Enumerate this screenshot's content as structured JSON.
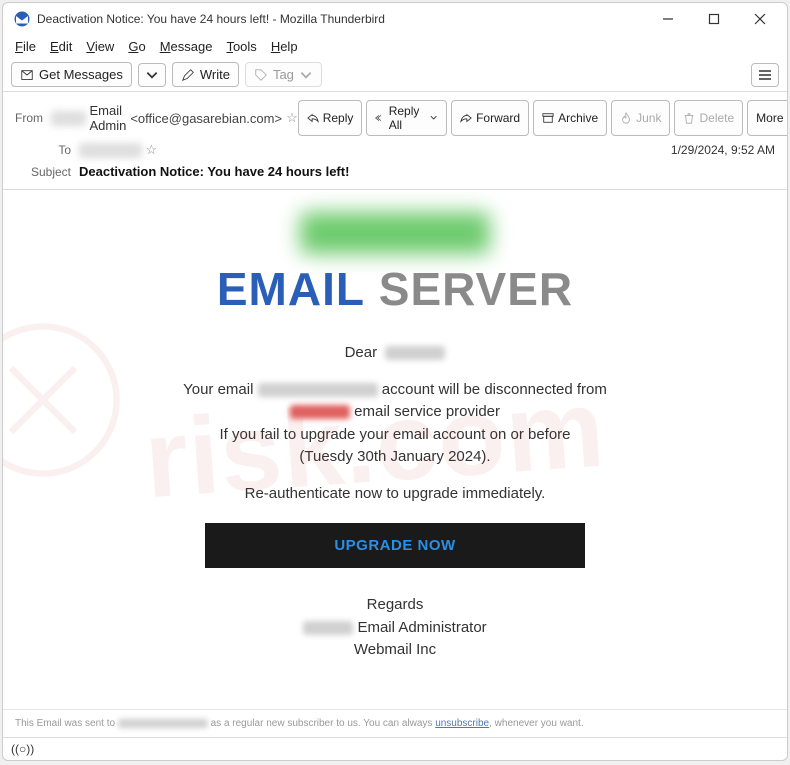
{
  "window": {
    "title": "Deactivation Notice: You have 24 hours left! - Mozilla Thunderbird"
  },
  "menu": {
    "items": [
      "File",
      "Edit",
      "View",
      "Go",
      "Message",
      "Tools",
      "Help"
    ]
  },
  "toolbar": {
    "get_messages": "Get Messages",
    "write": "Write",
    "tag": "Tag"
  },
  "header": {
    "from_label": "From",
    "from_name": "Email Admin",
    "from_addr": "<office@gasarebian.com>",
    "to_label": "To",
    "subject_label": "Subject",
    "subject": "Deactivation Notice: You have 24 hours left!",
    "date": "1/29/2024, 9:52 AM",
    "actions": {
      "reply": "Reply",
      "reply_all": "Reply All",
      "forward": "Forward",
      "archive": "Archive",
      "junk": "Junk",
      "delete": "Delete",
      "more": "More"
    }
  },
  "email": {
    "title_word1": "EMAIL",
    "title_word2": "SERVER",
    "greeting": "Dear",
    "line1a": "Your email",
    "line1b": "account will be disconnected from",
    "line2b": "email service provider",
    "line3": "If you fail to upgrade your email account on or before",
    "line4": "(Tuesdy 30th January 2024).",
    "line5": "Re-authenticate now to upgrade immediately.",
    "button": "UPGRADE NOW",
    "sig1": "Regards",
    "sig2": "Email Administrator",
    "sig3": "Webmail Inc"
  },
  "footer": {
    "prefix": "This Email was sent to",
    "mid": "as a regular new subscriber to us. You can always",
    "unsubscribe": "unsubscribe",
    "suffix": ", whenever you want."
  },
  "status": {
    "icon": "((○))"
  }
}
